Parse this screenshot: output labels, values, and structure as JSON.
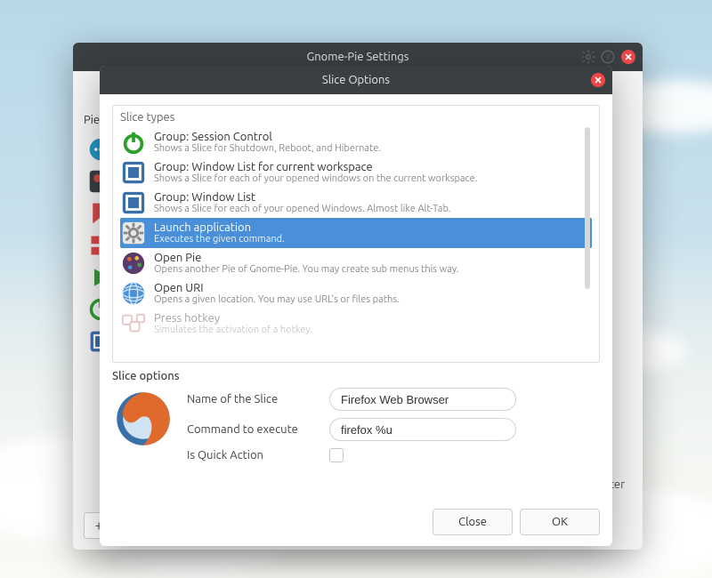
{
  "sky": {},
  "settings_window": {
    "title": "Gnome-Pie Settings",
    "sidebar_label": "Pies",
    "add_label": "+",
    "ter_label": "ter"
  },
  "options_dialog": {
    "title": "Slice Options",
    "types_header": "Slice types",
    "types": [
      {
        "icon": "power-green",
        "title": "Group: Session Control",
        "sub": "Shows a Slice for Shutdown, Reboot, and Hibernate.",
        "selected": false
      },
      {
        "icon": "window-blue",
        "title": "Group: Window List for current workspace",
        "sub": "Shows a Slice for each of your opened windows on the current workspace.",
        "selected": false
      },
      {
        "icon": "window-blue",
        "title": "Group: Window List",
        "sub": "Shows a Slice for each of your opened Windows. Almost like Alt-Tab.",
        "selected": false
      },
      {
        "icon": "gear-grey",
        "title": "Launch application",
        "sub": "Executes the given command.",
        "selected": true
      },
      {
        "icon": "palette",
        "title": "Open Pie",
        "sub": "Opens another Pie of Gnome-Pie. You may create sub menus this way.",
        "selected": false
      },
      {
        "icon": "globe",
        "title": "Open URI",
        "sub": "Opens a given location. You may use URL's or files paths.",
        "selected": false
      },
      {
        "icon": "keys",
        "title": "Press hotkey",
        "sub": "Simulates the activation of a hotkey.",
        "selected": false,
        "faded": true
      }
    ],
    "options_header": "Slice options",
    "form": {
      "name_label": "Name of the Slice",
      "name_value": "Firefox Web Browser",
      "cmd_label": "Command to execute",
      "cmd_value": "firefox %u",
      "quick_label": "Is Quick Action",
      "quick_checked": false
    },
    "buttons": {
      "close": "Close",
      "ok": "OK"
    },
    "colors": {
      "selection": "#4a90d9",
      "close_red": "#f04848"
    }
  }
}
